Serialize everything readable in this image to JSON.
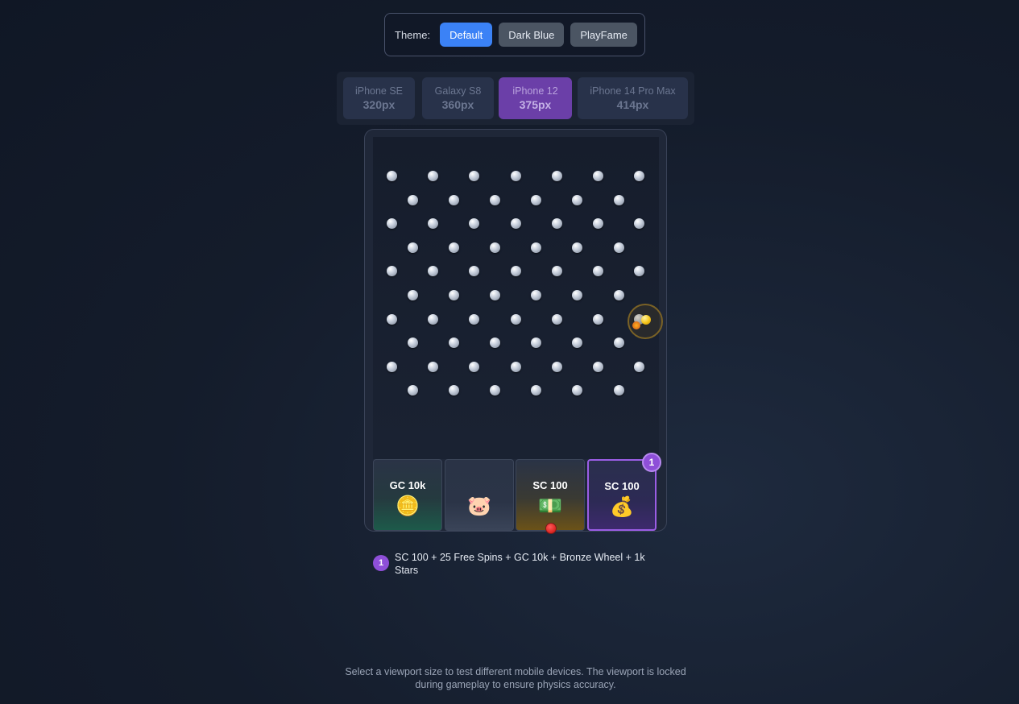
{
  "theme": {
    "label": "Theme:",
    "options": [
      "Default",
      "Dark Blue",
      "PlayFame"
    ],
    "selected": "Default"
  },
  "devices": [
    {
      "name": "iPhone SE",
      "size": "320px"
    },
    {
      "name": "Galaxy S8",
      "size": "360px"
    },
    {
      "name": "iPhone 12",
      "size": "375px"
    },
    {
      "name": "iPhone 14 Pro Max",
      "size": "414px"
    }
  ],
  "selected_device": "iPhone 12",
  "buckets": [
    {
      "label": "GC 10k",
      "icon": "gold-coins-icon",
      "glyph": "🪙"
    },
    {
      "label": "",
      "icon": "piggy-bank-icon",
      "glyph": "🐷"
    },
    {
      "label": "SC 100",
      "icon": "cash-stack-icon",
      "glyph": "💵"
    },
    {
      "label": "SC 100",
      "icon": "cash-coins-icon",
      "glyph": "💰"
    }
  ],
  "highlighted_bucket_badge": "1",
  "legend": {
    "badge": "1",
    "text": "SC 100 + 25 Free Spins + GC 10k + Bronze Wheel + 1k Stars"
  },
  "footer": "Select a viewport size to test different mobile devices. The viewport is locked during gameplay to ensure physics accuracy.",
  "colors": {
    "accent_blue": "#3b82f6",
    "accent_purple": "#6b3fa8",
    "badge_purple": "#8e4fd8",
    "ball_gold": "#f5c518",
    "marker_red": "#d9241f"
  }
}
